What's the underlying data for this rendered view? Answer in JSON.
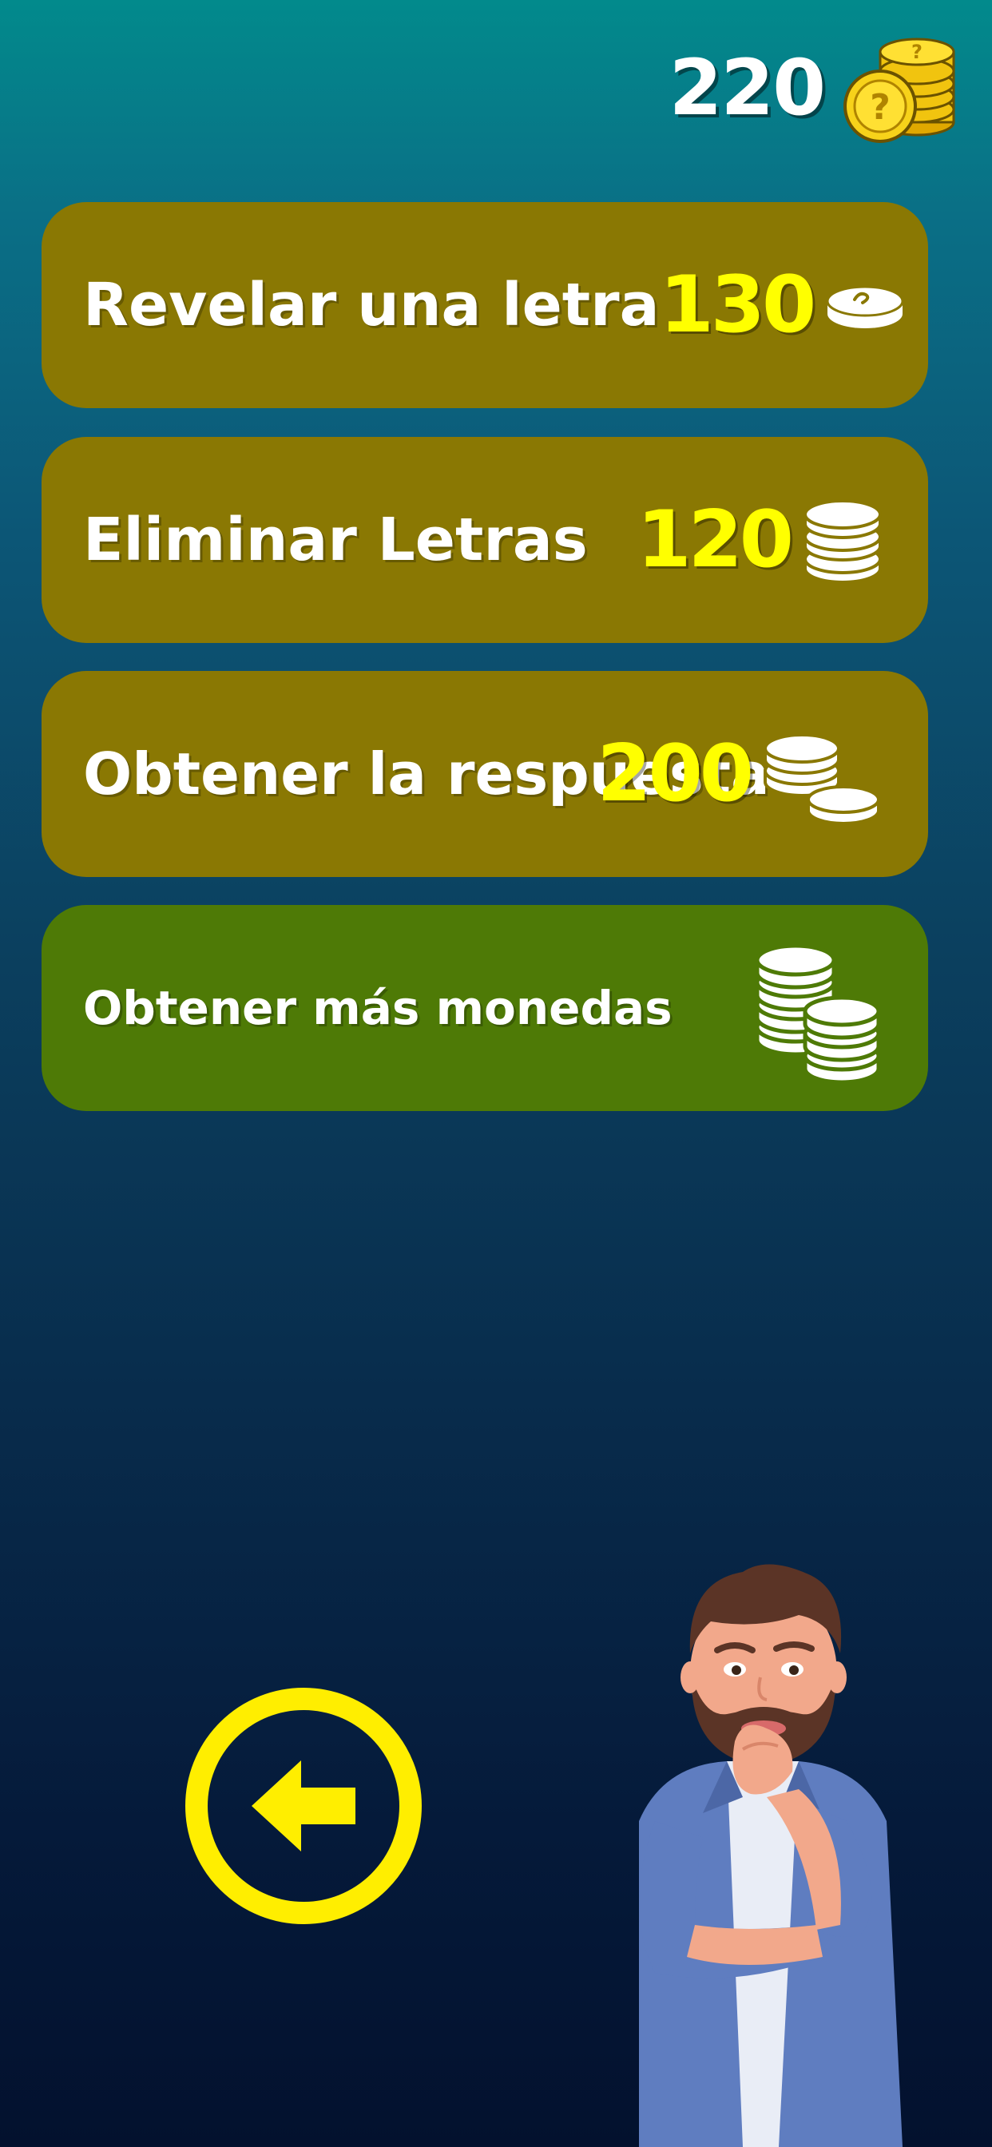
{
  "coins": {
    "balance": "220"
  },
  "options": [
    {
      "label": "Revelar una letra",
      "cost": "130",
      "icon": "single-coin-icon"
    },
    {
      "label": "Eliminar Letras",
      "cost": "120",
      "icon": "coin-stack-icon"
    },
    {
      "label": "Obtener la respuesta",
      "cost": "200",
      "icon": "coin-stacks-icon"
    }
  ],
  "get_more": {
    "label": "Obtener más monedas",
    "icon": "coin-stacks-icon"
  },
  "back": {
    "icon": "arrow-left-icon"
  },
  "colors": {
    "option_bg": "#8a7803",
    "get_more_bg": "#4e7a06",
    "cost": "#ffff00",
    "back_accent": "#ffee00"
  }
}
